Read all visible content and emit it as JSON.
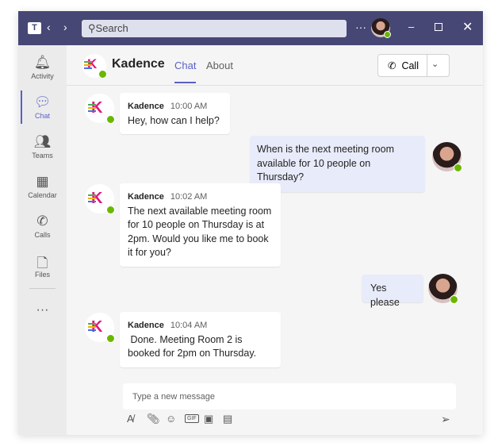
{
  "titlebar": {
    "search_placeholder": "Search"
  },
  "sidebar": {
    "items": [
      {
        "label": "Activity",
        "icon": "bell-icon"
      },
      {
        "label": "Chat",
        "icon": "chat-icon"
      },
      {
        "label": "Teams",
        "icon": "teams-icon"
      },
      {
        "label": "Calendar",
        "icon": "calendar-icon"
      },
      {
        "label": "Calls",
        "icon": "phone-icon"
      },
      {
        "label": "Files",
        "icon": "file-icon"
      }
    ]
  },
  "header": {
    "name": "Kadence",
    "tabs": [
      "Chat",
      "About"
    ],
    "call_label": "Call"
  },
  "messages": [
    {
      "sender": "Kadence",
      "time": "10:00 AM",
      "text": "Hey, how can I help?"
    },
    {
      "text": "When is the next meeting room available for 10 people on Thursday?"
    },
    {
      "sender": "Kadence",
      "time": "10:02 AM",
      "text": "The next available meeting room for 10 people on Thursday is at 2pm. Would you like me to book it for you?"
    },
    {
      "text": "Yes please"
    },
    {
      "sender": "Kadence",
      "time": "10:04 AM",
      "text": " Done. Meeting Room 2 is booked for 2pm on Thursday."
    }
  ],
  "compose": {
    "placeholder": "Type a new message",
    "gif": "GIF"
  },
  "colors": {
    "titlebar": "#464775",
    "accent": "#5b5fc7",
    "online": "#6bb700"
  }
}
